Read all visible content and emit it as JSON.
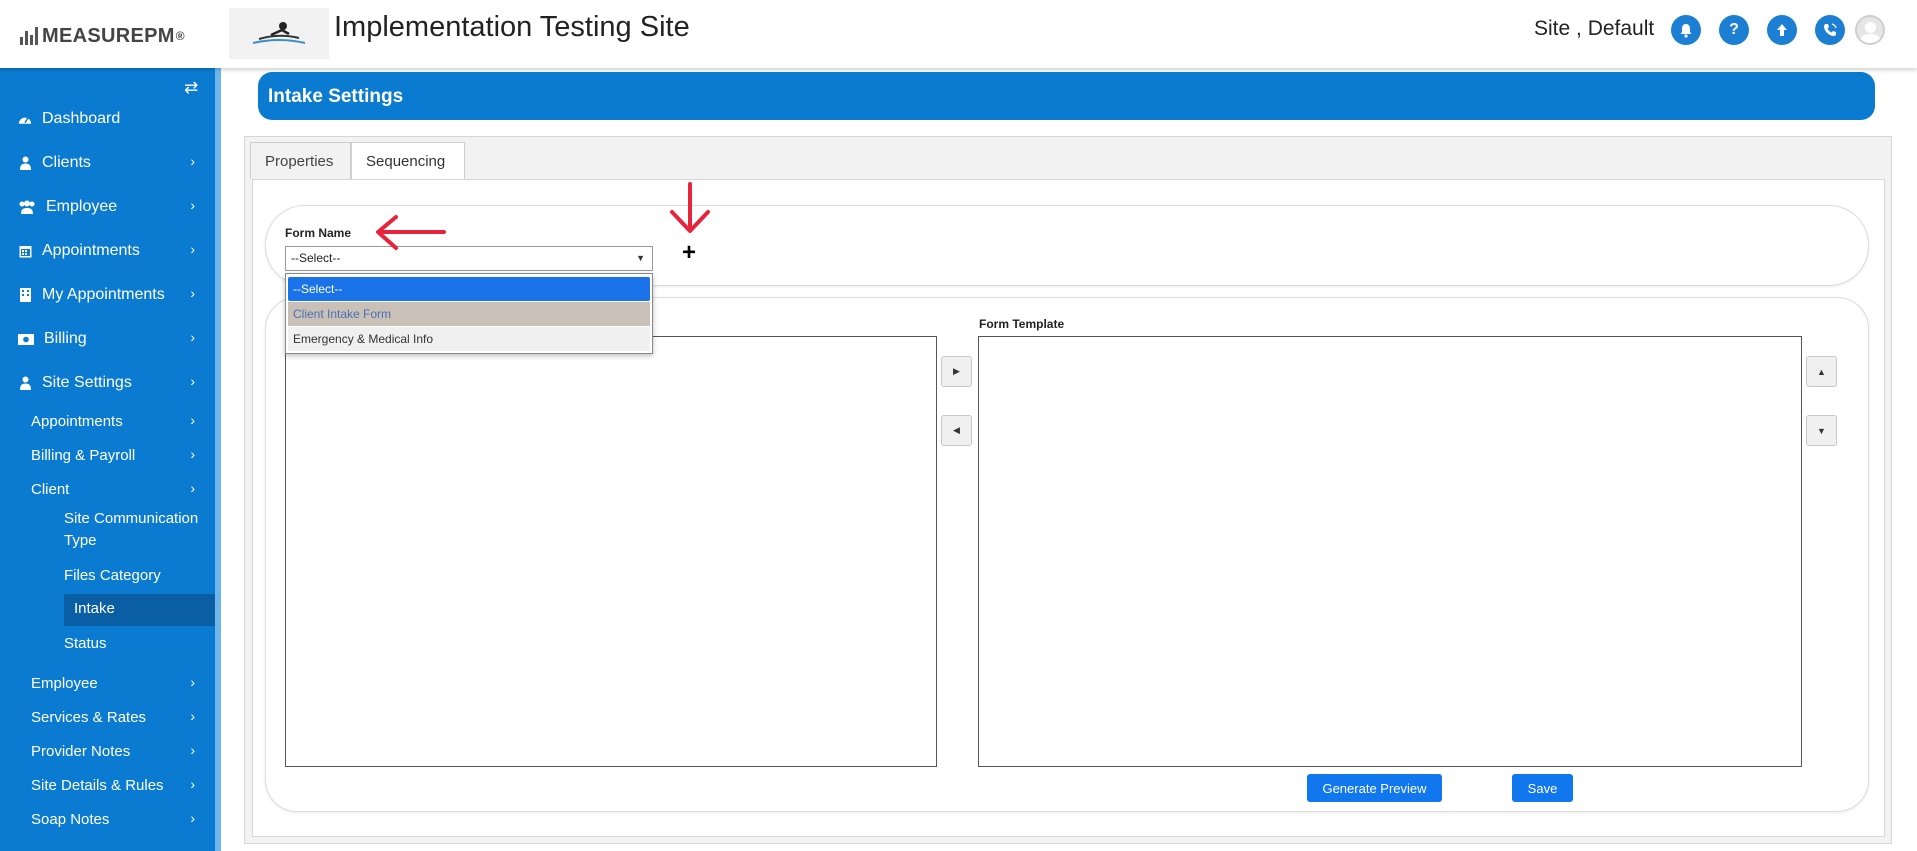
{
  "header": {
    "brand": "MEASURE",
    "brand_suffix": "PM",
    "brand_tm": "®",
    "site_title": "Implementation Testing Site",
    "user_label": "Site , Default",
    "icons": [
      "bell-icon",
      "help-icon",
      "upload-icon",
      "phone-icon",
      "user-avatar-icon"
    ]
  },
  "sidebar": {
    "toggle_icon": "⇄",
    "items": [
      {
        "label": "Dashboard",
        "icon": "dashboard-icon"
      },
      {
        "label": "Clients",
        "icon": "user-icon"
      },
      {
        "label": "Employee",
        "icon": "users-icon"
      },
      {
        "label": "Appointments",
        "icon": "calendar-icon"
      },
      {
        "label": "My Appointments",
        "icon": "building-icon"
      },
      {
        "label": "Billing",
        "icon": "money-icon"
      },
      {
        "label": "Site Settings",
        "icon": "user-icon"
      }
    ],
    "site_settings_children": [
      {
        "label": "Appointments"
      },
      {
        "label": "Billing & Payroll"
      },
      {
        "label": "Client"
      }
    ],
    "client_children": [
      {
        "label": "Site Communication Type"
      },
      {
        "label": "Files Category"
      },
      {
        "label": "Intake"
      },
      {
        "label": "Status"
      }
    ],
    "more_children": [
      {
        "label": "Employee"
      },
      {
        "label": "Services & Rates"
      },
      {
        "label": "Provider Notes"
      },
      {
        "label": "Site Details & Rules"
      },
      {
        "label": "Soap Notes"
      }
    ]
  },
  "page": {
    "title": "Intake Settings",
    "tabs": [
      {
        "label": "Properties",
        "active": false
      },
      {
        "label": "Sequencing",
        "active": true
      }
    ],
    "form_name_label": "Form Name",
    "form_select": {
      "value": "--Select--",
      "options": [
        "--Select--",
        "Client Intake Form",
        "Emergency & Medical Info"
      ]
    },
    "add_icon": "+",
    "form_template_label": "Form Template",
    "generate_preview_label": "Generate Preview",
    "save_label": "Save"
  },
  "colors": {
    "accent": "#0a7bd0",
    "sidebar_active": "#0a5ea4",
    "button_blue": "#1177ee",
    "annotation_red": "#e8243c"
  }
}
